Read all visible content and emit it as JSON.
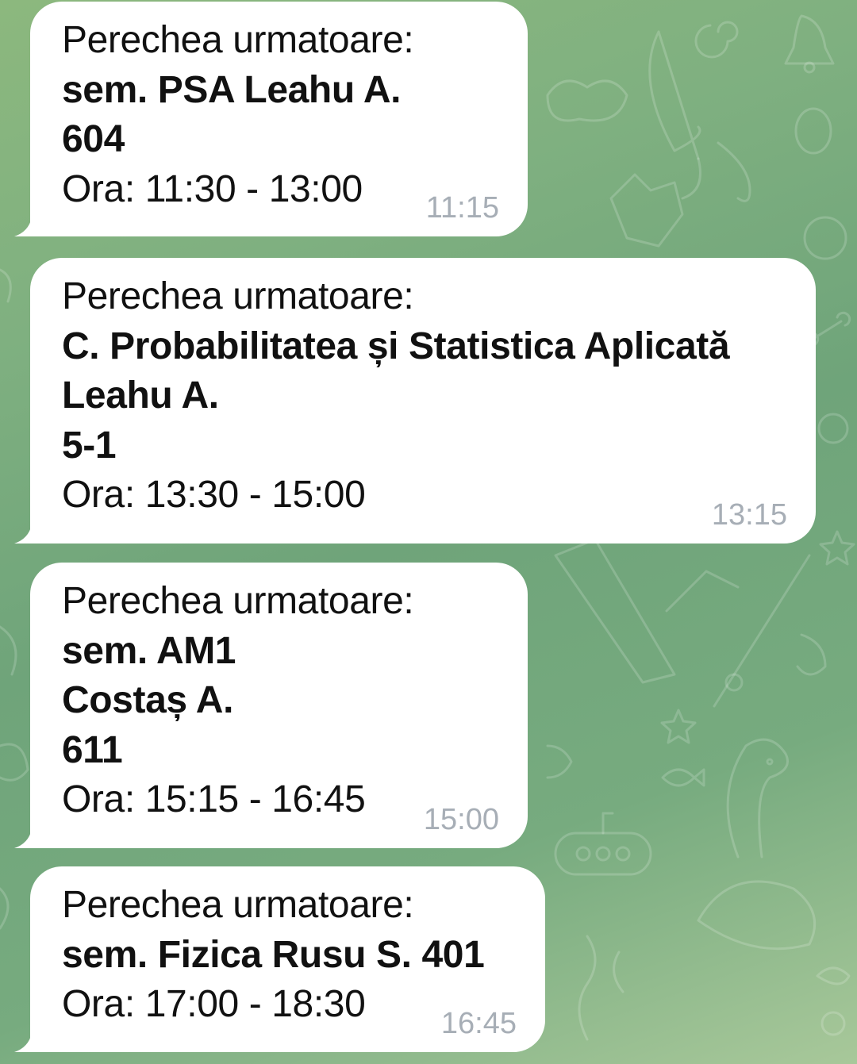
{
  "messages": [
    {
      "lines": [
        {
          "text": "Perechea urmatoare:",
          "bold": false
        },
        {
          "text": "sem. PSA Leahu A.",
          "bold": true
        },
        {
          "text": "604",
          "bold": true
        },
        {
          "text": "Ora: 11:30 - 13:00",
          "bold": false
        }
      ],
      "time": "11:15"
    },
    {
      "lines": [
        {
          "text": "Perechea urmatoare:",
          "bold": false
        },
        {
          "text": "C. Probabilitatea și Statistica Aplicată",
          "bold": true
        },
        {
          "text": "Leahu A.",
          "bold": true
        },
        {
          "text": "5-1",
          "bold": true
        },
        {
          "text": "Ora: 13:30 - 15:00",
          "bold": false
        }
      ],
      "time": "13:15"
    },
    {
      "lines": [
        {
          "text": "Perechea urmatoare:",
          "bold": false
        },
        {
          "text": "sem. AM1",
          "bold": true
        },
        {
          "text": "Costaș A.",
          "bold": true
        },
        {
          "text": "611",
          "bold": true
        },
        {
          "text": "Ora: 15:15 - 16:45",
          "bold": false
        }
      ],
      "time": "15:00"
    },
    {
      "lines": [
        {
          "text": "Perechea urmatoare:",
          "bold": false
        },
        {
          "text": "sem. Fizica Rusu S. 401",
          "bold": true
        },
        {
          "text": "Ora: 17:00 - 18:30",
          "bold": false
        }
      ],
      "time": "16:45"
    }
  ],
  "colors": {
    "bubble": "#ffffff",
    "text": "#111111",
    "timestamp": "#a7aeb6",
    "wallpaper_green": "#77ab7f"
  }
}
